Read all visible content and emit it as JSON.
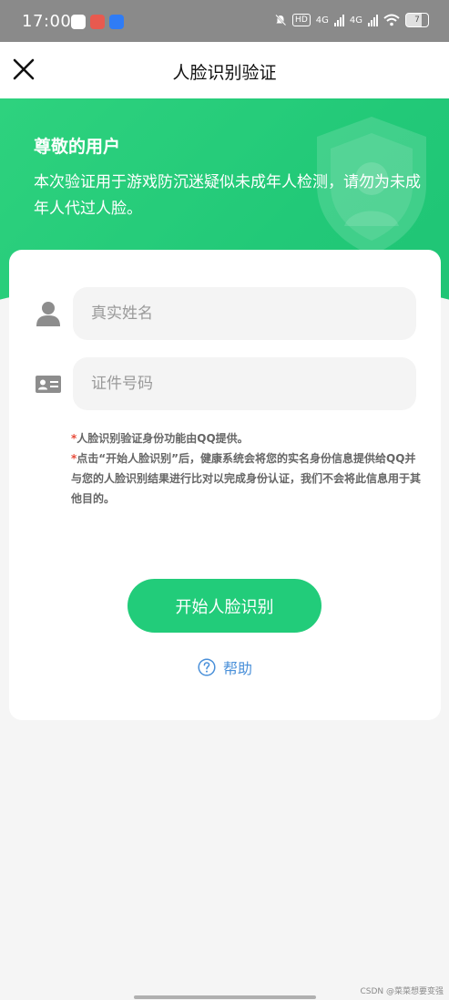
{
  "status_bar": {
    "time": "17:00",
    "hd_label": "HD",
    "network_1": "4G",
    "network_2": "4G",
    "battery": "7"
  },
  "nav": {
    "title": "人脸识别验证"
  },
  "banner": {
    "title": "尊敬的用户",
    "description": "本次验证用于游戏防沉迷疑似未成年人检测，请勿为未成年人代过人脸。"
  },
  "form": {
    "name_placeholder": "真实姓名",
    "id_placeholder": "证件号码"
  },
  "notes": {
    "star": "*",
    "line1": "人脸识别验证身份功能由QQ提供。",
    "line2": "点击“开始人脸识别”后，健康系统会将您的实名身份信息提供给QQ并与您的人脸识别结果进行比对以完成身份认证，我们不会将此信息用于其他目的。"
  },
  "actions": {
    "start_label": "开始人脸识别",
    "help_label": "帮助"
  },
  "footer": {
    "watermark": "CSDN @菜菜想要变强"
  },
  "colors": {
    "brand_green": "#22cc7a",
    "link_blue": "#4a90d9",
    "note_star_red": "#e84b3a"
  },
  "icons": {
    "close": "close-icon",
    "user": "user-icon",
    "id_card": "id-card-icon",
    "help": "help-icon",
    "shield": "shield-icon"
  }
}
